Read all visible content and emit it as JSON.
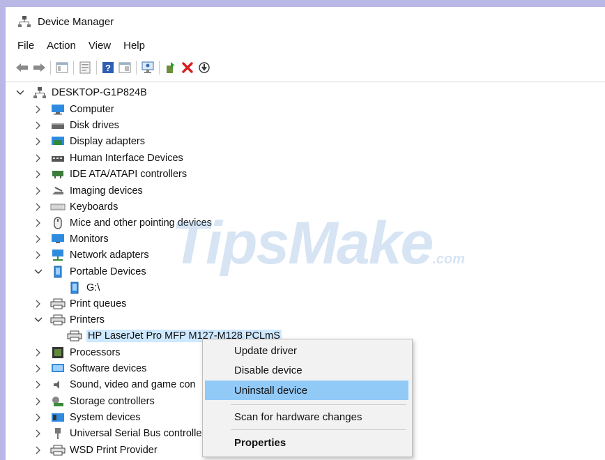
{
  "window": {
    "title": "Device Manager"
  },
  "menu": [
    "File",
    "Action",
    "View",
    "Help"
  ],
  "toolbar": [
    {
      "name": "back-arrow-icon"
    },
    {
      "name": "forward-arrow-icon"
    },
    {
      "name": "show-hide-console-tree-icon"
    },
    {
      "name": "properties-icon"
    },
    {
      "name": "help-icon"
    },
    {
      "name": "view-icon"
    },
    {
      "name": "scan-hardware-icon"
    },
    {
      "name": "update-driver-icon"
    },
    {
      "name": "uninstall-device-icon"
    },
    {
      "name": "disable-device-icon"
    }
  ],
  "tree": {
    "root": "DESKTOP-G1P824B",
    "items": [
      {
        "label": "Computer",
        "icon": "computer-icon"
      },
      {
        "label": "Disk drives",
        "icon": "disk-drive-icon"
      },
      {
        "label": "Display adapters",
        "icon": "display-adapter-icon"
      },
      {
        "label": "Human Interface Devices",
        "icon": "hid-icon"
      },
      {
        "label": "IDE ATA/ATAPI controllers",
        "icon": "ide-controller-icon"
      },
      {
        "label": "Imaging devices",
        "icon": "imaging-device-icon"
      },
      {
        "label": "Keyboards",
        "icon": "keyboard-icon"
      },
      {
        "label": "Mice and other pointing devices",
        "icon": "mouse-icon"
      },
      {
        "label": "Monitors",
        "icon": "monitor-icon"
      },
      {
        "label": "Network adapters",
        "icon": "network-adapter-icon"
      },
      {
        "label": "Portable Devices",
        "icon": "portable-device-icon",
        "expanded": true
      },
      {
        "label": "G:\\",
        "icon": "portable-device-icon",
        "child": true
      },
      {
        "label": "Print queues",
        "icon": "printer-icon"
      },
      {
        "label": "Printers",
        "icon": "printer-icon",
        "expanded": true
      },
      {
        "label": "HP LaserJet Pro MFP M127-M128 PCLmS",
        "icon": "printer-icon",
        "child": true,
        "selected": true
      },
      {
        "label": "Processors",
        "icon": "processor-icon"
      },
      {
        "label": "Software devices",
        "icon": "software-device-icon"
      },
      {
        "label": "Sound, video and game con",
        "icon": "sound-icon"
      },
      {
        "label": "Storage controllers",
        "icon": "storage-controller-icon"
      },
      {
        "label": "System devices",
        "icon": "system-device-icon"
      },
      {
        "label": "Universal Serial Bus controlle",
        "icon": "usb-icon"
      },
      {
        "label": "WSD Print Provider",
        "icon": "printer-icon"
      }
    ]
  },
  "watermark": {
    "main": "TipsMake",
    "suffix": ".com"
  },
  "context_menu": {
    "items": [
      "Update driver",
      "Disable device",
      "Uninstall device",
      "Scan for hardware changes",
      "Properties"
    ],
    "highlighted": "Uninstall device"
  }
}
